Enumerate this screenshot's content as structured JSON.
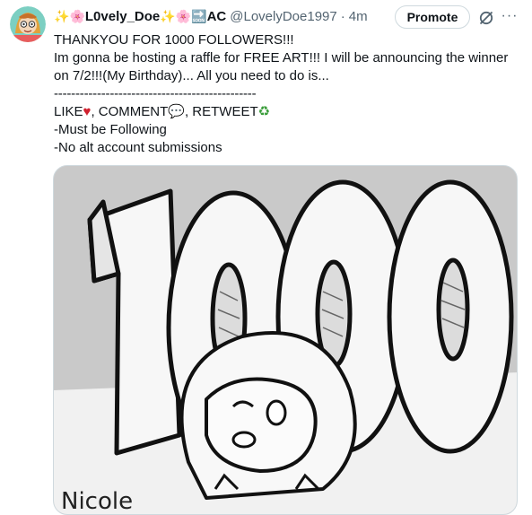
{
  "tweet": {
    "display_name": "L0vely_Doe",
    "name_suffix": "AC",
    "handle": "@LovelyDoe1997",
    "separator": "·",
    "time": "4m",
    "promote_label": "Promote",
    "more_label": "···",
    "lines": [
      "THANKYOU FOR 1000 FOLLOWERS!!!",
      "Im gonna be hosting a raffle for FREE ART!!! I will be announcing the winner on 7/2!!!(My Birthday)... All you need to do is...",
      "-----------------------------------------------",
      "-Must be Following",
      "-No alt account submissions"
    ],
    "action_line": {
      "like": "LIKE",
      "comment": ", COMMENT",
      "retweet": ", RETWEET"
    },
    "media": {
      "big_text": "1000",
      "signature": "Nicole"
    }
  },
  "icons": {
    "sparkle": "✨",
    "flower": "🌸",
    "soon_arrow": "🔜",
    "heart": "♥",
    "speech": "💬",
    "recycle": "♻"
  },
  "colors": {
    "text": "#0f1419",
    "secondary": "#536471",
    "border": "#cfd9de",
    "heart": "#d0202e"
  }
}
